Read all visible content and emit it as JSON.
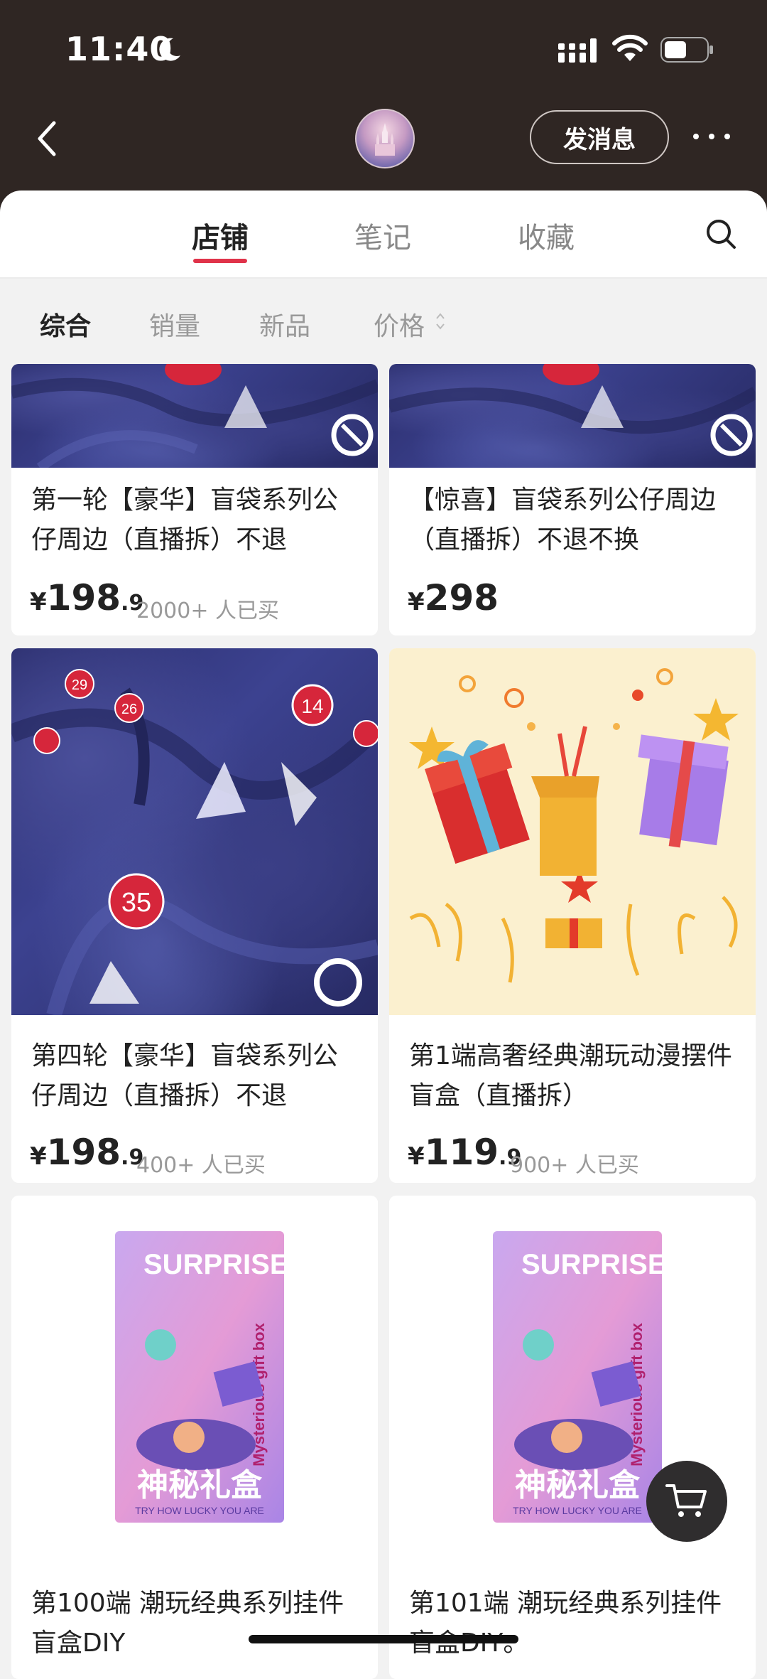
{
  "status_bar": {
    "time": "11:40"
  },
  "header": {
    "message_button": "发消息"
  },
  "tabs": [
    {
      "label": "店铺",
      "active": true
    },
    {
      "label": "笔记",
      "active": false
    },
    {
      "label": "收藏",
      "active": false
    }
  ],
  "filters": [
    {
      "label": "综合",
      "active": true
    },
    {
      "label": "销量",
      "active": false
    },
    {
      "label": "新品",
      "active": false
    },
    {
      "label": "价格",
      "active": false
    }
  ],
  "products": [
    {
      "title": "第一轮【豪华】盲袋系列公仔周边（直播拆）不退",
      "currency": "¥",
      "price_int": "198",
      "price_dec": ".9",
      "sold": "2000+ 人已买"
    },
    {
      "title": "【惊喜】盲袋系列公仔周边（直播拆）不退不换",
      "currency": "¥",
      "price_int": "298",
      "price_dec": "",
      "sold": ""
    },
    {
      "title": "第四轮【豪华】盲袋系列公仔周边（直播拆）不退",
      "currency": "¥",
      "price_int": "198",
      "price_dec": ".9",
      "sold": "400+ 人已买"
    },
    {
      "title": "第1端高奢经典潮玩动漫摆件盲盒（直播拆）",
      "currency": "¥",
      "price_int": "119",
      "price_dec": ".9",
      "sold": "900+ 人已买"
    },
    {
      "title": "第100端 潮玩经典系列挂件盲盒DIY",
      "currency": "",
      "price_int": "",
      "price_dec": "",
      "sold": ""
    },
    {
      "title": "第101端 潮玩经典系列挂件盲盒DIY。",
      "currency": "",
      "price_int": "",
      "price_dec": "",
      "sold": ""
    }
  ],
  "image_text": {
    "tag_35": "35",
    "tag_14": "14",
    "tag_26": "26",
    "tag_29": "29",
    "box_brand": "SURPRISE",
    "box_side": "Mysterious gift box",
    "box_title": "神秘礼盒",
    "box_slogan": "TRY HOW LUCKY YOU ARE"
  },
  "colors": {
    "header_bg": "#2f2623",
    "accent": "#e0334a",
    "page_bg": "#f2f2f2"
  },
  "icons": [
    "back-icon",
    "more-icon",
    "search-icon",
    "sort-icon",
    "cart-icon",
    "moon-icon",
    "signal-icon",
    "wifi-icon",
    "battery-icon"
  ]
}
